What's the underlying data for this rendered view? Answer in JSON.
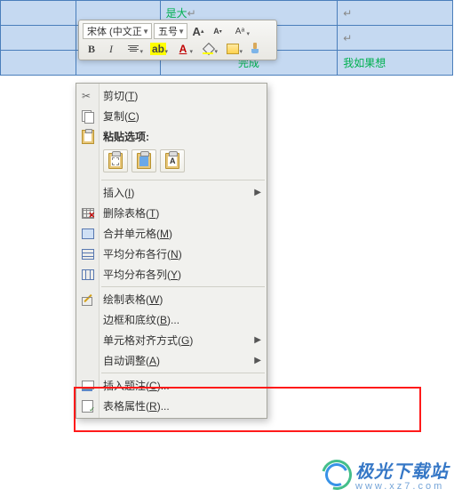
{
  "table": {
    "rows": [
      {
        "c3_text": "是大",
        "c4_text": ""
      },
      {
        "c3_text": "",
        "c4_text": ""
      },
      {
        "c3_text": "完成",
        "c4_text": "我如果想"
      }
    ]
  },
  "mini_toolbar": {
    "font_name": "宋体 (中文正",
    "font_size": "五号",
    "grow_font": "A",
    "shrink_font": "A",
    "bold": "B",
    "italic": "I",
    "highlight_letter": "ab",
    "font_color_letter": "A"
  },
  "context_menu": {
    "cut": {
      "label": "剪切",
      "hotkey": "T"
    },
    "copy": {
      "label": "复制",
      "hotkey": "C"
    },
    "paste_options_label": "粘贴选项:",
    "insert": {
      "label": "插入",
      "hotkey": "I"
    },
    "delete_table": {
      "label": "删除表格",
      "hotkey": "T"
    },
    "merge_cells": {
      "label": "合并单元格",
      "hotkey": "M"
    },
    "dist_rows": {
      "label": "平均分布各行",
      "hotkey": "N"
    },
    "dist_cols": {
      "label": "平均分布各列",
      "hotkey": "Y"
    },
    "draw_table": {
      "label": "绘制表格",
      "hotkey": "W"
    },
    "borders": {
      "label": "边框和底纹",
      "hotkey": "B",
      "suffix": "..."
    },
    "align": {
      "label": "单元格对齐方式",
      "hotkey": "G"
    },
    "autofit": {
      "label": "自动调整",
      "hotkey": "A"
    },
    "caption": {
      "label": "插入题注",
      "hotkey": "C",
      "suffix": "..."
    },
    "properties": {
      "label": "表格属性",
      "hotkey": "R",
      "suffix": "..."
    }
  },
  "watermark": {
    "main": "极光下载站",
    "sub": "www.xz7.com"
  }
}
